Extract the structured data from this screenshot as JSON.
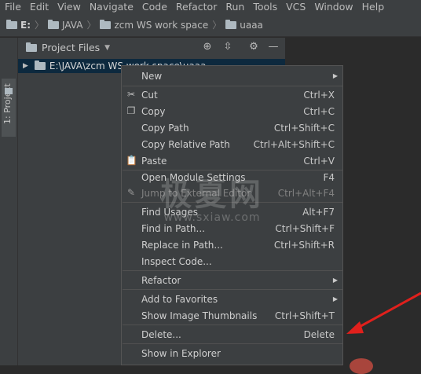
{
  "menubar": [
    "File",
    "Edit",
    "View",
    "Navigate",
    "Code",
    "Refactor",
    "Run",
    "Tools",
    "VCS",
    "Window",
    "Help"
  ],
  "breadcrumb": [
    "E:",
    "JAVA",
    "zcm WS work space",
    "uaaa"
  ],
  "sidebar": {
    "tab_label": "1: Project"
  },
  "project_panel": {
    "title": "Project Files",
    "root_path": "E:\\JAVA\\zcm WS work space\\uaaa"
  },
  "context_menu": {
    "items": [
      {
        "label": "New",
        "shortcut": "",
        "submenu": true,
        "icon": "",
        "disabled": false
      },
      {
        "label": "Cut",
        "shortcut": "Ctrl+X",
        "submenu": false,
        "icon": "scissors-icon",
        "disabled": false
      },
      {
        "label": "Copy",
        "shortcut": "Ctrl+C",
        "submenu": false,
        "icon": "copy-icon",
        "disabled": false
      },
      {
        "label": "Copy Path",
        "shortcut": "Ctrl+Shift+C",
        "submenu": false,
        "icon": "",
        "disabled": false
      },
      {
        "label": "Copy Relative Path",
        "shortcut": "Ctrl+Alt+Shift+C",
        "submenu": false,
        "icon": "",
        "disabled": false
      },
      {
        "label": "Paste",
        "shortcut": "Ctrl+V",
        "submenu": false,
        "icon": "paste-icon",
        "disabled": false
      },
      {
        "label": "Open Module Settings",
        "shortcut": "F4",
        "submenu": false,
        "icon": "",
        "disabled": false
      },
      {
        "label": "Jump to External Editor",
        "shortcut": "Ctrl+Alt+F4",
        "submenu": false,
        "icon": "edit-icon",
        "disabled": true
      },
      {
        "label": "Find Usages",
        "shortcut": "Alt+F7",
        "submenu": false,
        "icon": "",
        "disabled": false
      },
      {
        "label": "Find in Path...",
        "shortcut": "Ctrl+Shift+F",
        "submenu": false,
        "icon": "",
        "disabled": false
      },
      {
        "label": "Replace in Path...",
        "shortcut": "Ctrl+Shift+R",
        "submenu": false,
        "icon": "",
        "disabled": false
      },
      {
        "label": "Inspect Code...",
        "shortcut": "",
        "submenu": false,
        "icon": "",
        "disabled": false
      },
      {
        "label": "Refactor",
        "shortcut": "",
        "submenu": true,
        "icon": "",
        "disabled": false
      },
      {
        "label": "Add to Favorites",
        "shortcut": "",
        "submenu": true,
        "icon": "",
        "disabled": false
      },
      {
        "label": "Show Image Thumbnails",
        "shortcut": "Ctrl+Shift+T",
        "submenu": false,
        "icon": "",
        "disabled": false
      },
      {
        "label": "Delete...",
        "shortcut": "Delete",
        "submenu": false,
        "icon": "",
        "disabled": false
      },
      {
        "label": "Show in Explorer",
        "shortcut": "",
        "submenu": false,
        "icon": "",
        "disabled": false
      }
    ]
  },
  "watermark": {
    "main": "极夏网",
    "sub": "www.sxiaw.com"
  },
  "colors": {
    "menu_bg": "#3c3f41",
    "editor_bg": "#2b2b2b",
    "selection": "#0d293e",
    "arrow": "#e0201c"
  }
}
